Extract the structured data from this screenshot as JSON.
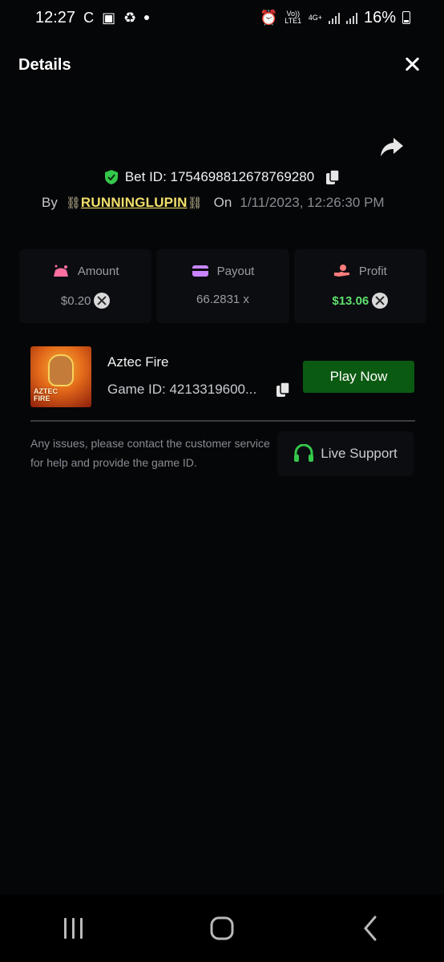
{
  "status_bar": {
    "time": "12:27",
    "network_label": "Vo)) LTE1",
    "network_type": "4G+",
    "battery": "16%",
    "icons": [
      "c-icon",
      "briefcase-icon",
      "share-network-icon",
      "notification-dot",
      "alarm-icon",
      "signal-icon",
      "signal-icon",
      "battery-charging-icon"
    ]
  },
  "header": {
    "title": "Details"
  },
  "bet": {
    "id_label": "Bet ID: 1754698812678769280",
    "by_label": "By",
    "username": "RUNNINGLUPIN",
    "username_prefix": "⛓",
    "username_suffix": "⛓",
    "on_label": "On",
    "date": "1/11/2023, 12:26:30 PM"
  },
  "stats": [
    {
      "label": "Amount",
      "value": "$0.20",
      "icon": "amount-icon",
      "color": "#ff6fa0"
    },
    {
      "label": "Payout",
      "value": "66.2831 x",
      "icon": "card-icon",
      "color": "#c985ff"
    },
    {
      "label": "Profit",
      "value": "$13.06",
      "icon": "hand-coin-icon",
      "color": "#ff7c7c"
    }
  ],
  "game": {
    "name": "Aztec Fire",
    "id_text": "Game ID: 4213319600...",
    "thumb_text_1": "AZTEC",
    "thumb_text_2": "FIRE",
    "play_label": "Play Now"
  },
  "support": {
    "help_text": "Any issues, please contact the customer service for help and provide the game ID.",
    "button_label": "Live Support"
  },
  "colors": {
    "background": "#050608",
    "accent_green": "#0b5a12",
    "profit_green": "#5ee06c",
    "username_yellow": "#f3e06a"
  }
}
